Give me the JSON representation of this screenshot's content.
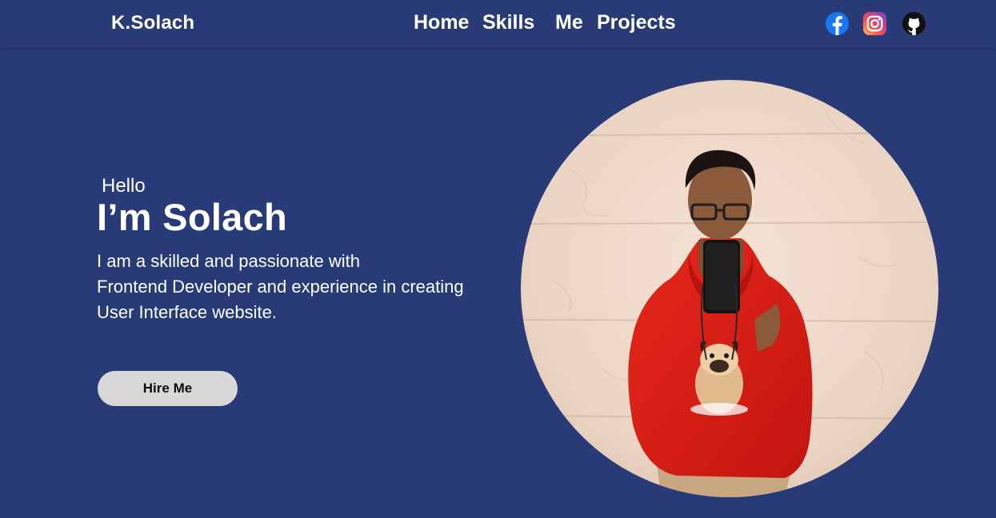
{
  "brand": "K.Solach",
  "nav": {
    "home": "Home",
    "skills": "Skills",
    "me": "Me",
    "projects": "Projects"
  },
  "social": [
    {
      "icon": "facebook-icon",
      "color": "#1877f2"
    },
    {
      "icon": "instagram-icon",
      "color": "#e1306c"
    },
    {
      "icon": "github-icon",
      "color": "#111111"
    }
  ],
  "hero": {
    "greeting": "Hello",
    "headline": "I’m Solach",
    "bio_lines": [
      "I am a skilled and passionate with",
      "Frontend Developer and experience in creating",
      "User Interface website."
    ],
    "cta_label": "Hire Me"
  },
  "portrait": {
    "icon": "profile-photo"
  },
  "colors": {
    "background": "#283b77",
    "text": "#ffffff",
    "button": "#d8d8d8",
    "button_text": "#0c0c0c"
  }
}
